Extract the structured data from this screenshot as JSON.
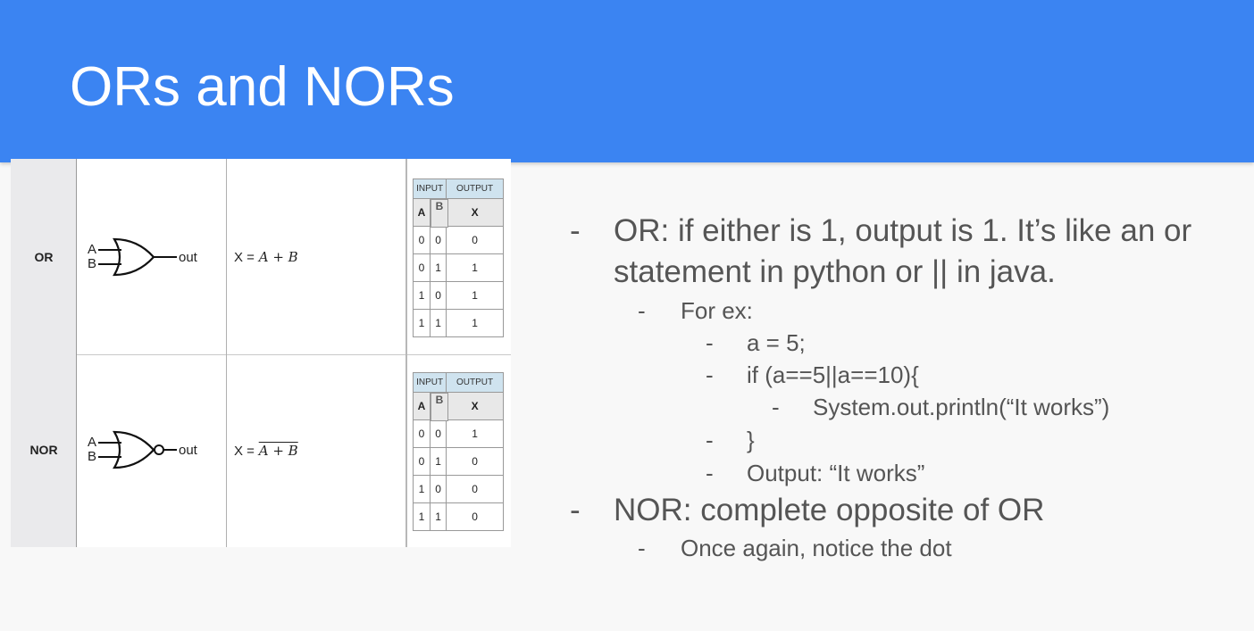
{
  "slide": {
    "title": "ORs and NORs"
  },
  "gate_table": {
    "rows": [
      {
        "name": "OR",
        "input_a": "A",
        "input_b": "B",
        "output_label": "out",
        "equation_x": "X =",
        "equation": "A + B",
        "truth_table": {
          "group_headers": [
            "INPUT",
            "OUTPUT"
          ],
          "column_headers": [
            "A",
            "B",
            "X"
          ],
          "rows": [
            [
              "0",
              "0",
              "0"
            ],
            [
              "0",
              "1",
              "1"
            ],
            [
              "1",
              "0",
              "1"
            ],
            [
              "1",
              "1",
              "1"
            ]
          ]
        }
      },
      {
        "name": "NOR",
        "input_a": "A",
        "input_b": "B",
        "output_label": "out",
        "equation_x": "X =",
        "equation": "A + B",
        "truth_table": {
          "group_headers": [
            "INPUT",
            "OUTPUT"
          ],
          "column_headers": [
            "A",
            "B",
            "X"
          ],
          "rows": [
            [
              "0",
              "0",
              "1"
            ],
            [
              "0",
              "1",
              "0"
            ],
            [
              "1",
              "0",
              "0"
            ],
            [
              "1",
              "1",
              "0"
            ]
          ]
        }
      }
    ]
  },
  "bullets": {
    "dash": "-",
    "or_line1": "OR: if either is 1, output is 1. It’s like an or",
    "or_line2": "statement in python or || in java.",
    "for_ex": "For ex:",
    "code1": "a = 5;",
    "code2": "if (a==5||a==10){",
    "code3": "System.out.println(“It works”)",
    "code4": "}",
    "code5": "Output: “It works”",
    "nor": "NOR: complete opposite of OR",
    "nor_sub": "Once again, notice the dot"
  }
}
